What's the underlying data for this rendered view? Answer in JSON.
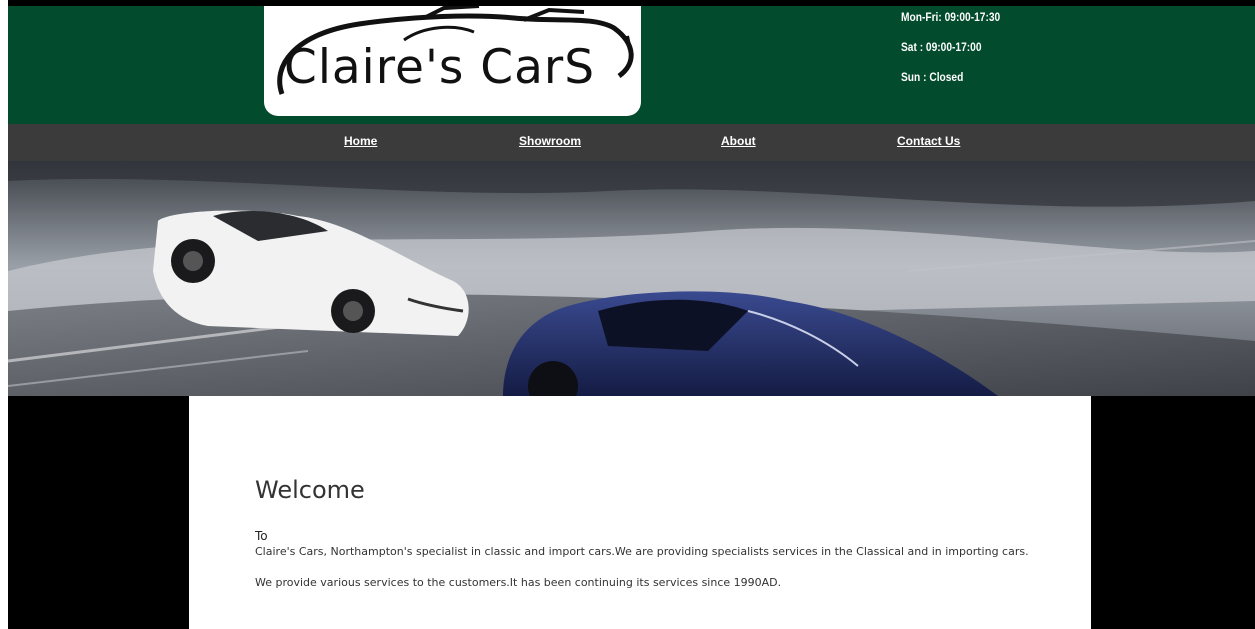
{
  "brand": {
    "logo_text": "Claire's CarS"
  },
  "opening_hours": [
    "Mon-Fri: 09:00-17:30",
    "Sat : 09:00-17:00",
    "Sun : Closed"
  ],
  "nav": {
    "items": [
      {
        "label": "Home"
      },
      {
        "label": "Showroom"
      },
      {
        "label": "About"
      },
      {
        "label": "Contact Us"
      }
    ]
  },
  "main": {
    "heading": "Welcome",
    "to_label": "To",
    "paragraphs": [
      "Claire's Cars, Northampton's specialist in classic and import cars.We are providing specialists services in the Classical and in importing cars.",
      "We provide various services to the customers.It has been continuing its services since 1990AD."
    ]
  },
  "colors": {
    "header_green": "#024b2c",
    "nav_gray": "#3b3b3b",
    "page_black": "#000000"
  }
}
